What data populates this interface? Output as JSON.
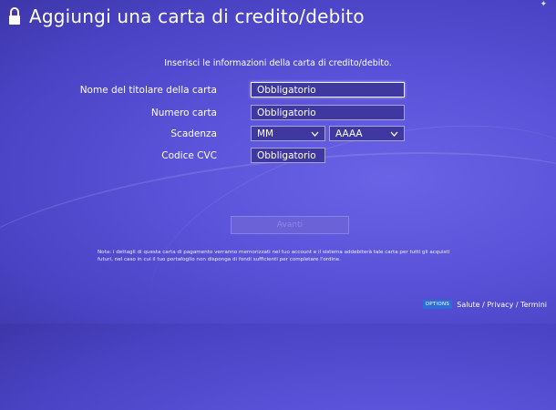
{
  "header": {
    "title": "Aggiungi una carta di credito/debito",
    "corner_mark": "✦"
  },
  "intro": "Inserisci le informazioni della carta di credito/debito.",
  "form": {
    "holder": {
      "label": "Nome del titolare della carta",
      "placeholder": "Obbligatorio"
    },
    "number": {
      "label": "Numero carta",
      "placeholder": "Obbligatorio"
    },
    "expiry": {
      "label": "Scadenza",
      "month": "MM",
      "year": "AAAA"
    },
    "cvc": {
      "label": "Codice CVC",
      "placeholder": "Obbligatorio"
    }
  },
  "continue_button": {
    "label": "Avanti"
  },
  "note": "Nota: i dettagli di questa carta di pagamento verranno memorizzati nel tuo account e il sistema addebiterà tale carta per tutti gli acquisti futuri, nel caso in cui il tuo portafoglio non disponga di fondi sufficienti per completare l'ordine.",
  "footer": {
    "options": "OPTIONS",
    "links": "Salute / Privacy / Termini"
  }
}
